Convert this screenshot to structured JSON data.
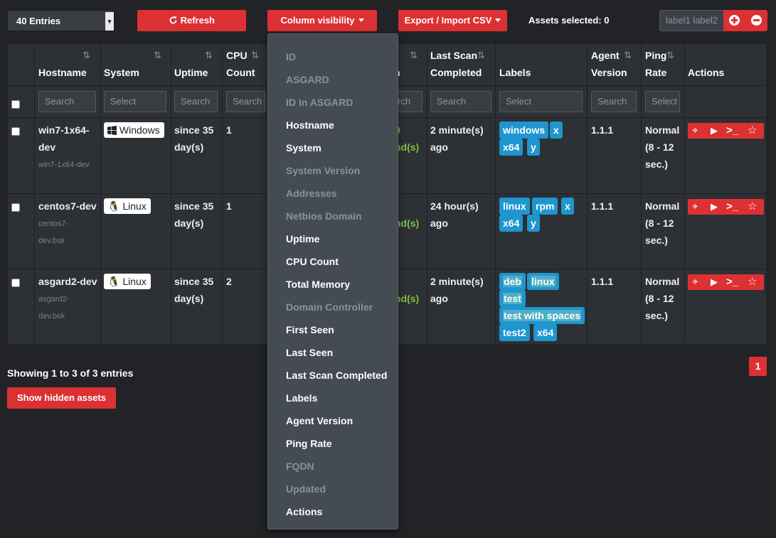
{
  "toolbar": {
    "entries": "40 Entries",
    "refresh": "Refresh",
    "column_visibility": "Column visibility",
    "export_import": "Export / Import CSV",
    "assets_selected": "Assets selected: 0",
    "label_input_placeholder": "label1 label2"
  },
  "columns": {
    "hostname": "Hostname",
    "system": "System",
    "uptime": "Uptime",
    "cpu_count_1": "CPU",
    "cpu_count_2": "Count",
    "partial_col": "n",
    "last_scan_1": "Last Scan",
    "last_scan_2": "Completed",
    "labels": "Labels",
    "agent_version_1": "Agent",
    "agent_version_2": "Version",
    "ping_rate_1": "Ping",
    "ping_rate_2": "Rate",
    "actions": "Actions"
  },
  "filters": {
    "hostname": "Search",
    "system": "Select",
    "uptime": "Search",
    "cpu": "Search",
    "partial": "rch",
    "last_scan": "Search",
    "labels": "Select",
    "agent": "Search",
    "ping": "Select"
  },
  "rows": [
    {
      "hostname_1": "win7-1x64-",
      "hostname_2": "dev",
      "fqdn_1": "win7-1x64-dev",
      "fqdn_2": "",
      "system": "Windows",
      "uptime_1": "since 35",
      "uptime_2": "day(s)",
      "cpu": "1",
      "partial_1": "0",
      "partial_2": "nd(s)",
      "last_scan_1": "2 minute(s)",
      "last_scan_2": "ago",
      "labels": [
        "windows",
        "x",
        "x64",
        "y"
      ],
      "agent": "1.1.1",
      "ping_1": "Normal",
      "ping_2": "(8 - 12",
      "ping_3": "sec.)"
    },
    {
      "hostname_1": "centos7-dev",
      "hostname_2": "",
      "fqdn_1": "centos7-",
      "fqdn_2": "dev.bsk",
      "system": "Linux",
      "uptime_1": "since 35",
      "uptime_2": "day(s)",
      "cpu": "1",
      "partial_1": "",
      "partial_2": "nd(s)",
      "last_scan_1": "24 hour(s)",
      "last_scan_2": "ago",
      "labels": [
        "linux",
        "rpm",
        "x",
        "x64",
        "y"
      ],
      "agent": "1.1.1",
      "ping_1": "Normal",
      "ping_2": "(8 - 12",
      "ping_3": "sec.)"
    },
    {
      "hostname_1": "asgard2-dev",
      "hostname_2": "",
      "fqdn_1": "asgard2-",
      "fqdn_2": "dev.bsk",
      "system": "Linux",
      "uptime_1": "since 35",
      "uptime_2": "day(s)",
      "cpu": "2",
      "partial_1": "",
      "partial_2": "nd(s)",
      "last_scan_1": "2 minute(s)",
      "last_scan_2": "ago",
      "labels": [
        "deb",
        "linux",
        "test",
        "test with spaces",
        "test2",
        "x64"
      ],
      "agent": "1.1.1",
      "ping_1": "Normal",
      "ping_2": "(8 - 12",
      "ping_3": "sec.)"
    }
  ],
  "footer": {
    "showing": "Showing 1 to 3 of 3 entries",
    "show_hidden": "Show hidden assets",
    "page": "1"
  },
  "column_menu": [
    {
      "label": "ID",
      "visible": false
    },
    {
      "label": "ASGARD",
      "visible": false
    },
    {
      "label": "ID in ASGARD",
      "visible": false
    },
    {
      "label": "Hostname",
      "visible": true
    },
    {
      "label": "System",
      "visible": true
    },
    {
      "label": "System Version",
      "visible": false
    },
    {
      "label": "Addresses",
      "visible": false
    },
    {
      "label": "Netbios Domain",
      "visible": false
    },
    {
      "label": "Uptime",
      "visible": true
    },
    {
      "label": "CPU Count",
      "visible": true
    },
    {
      "label": "Total Memory",
      "visible": true
    },
    {
      "label": "Domain Controller",
      "visible": false
    },
    {
      "label": "First Seen",
      "visible": true
    },
    {
      "label": "Last Seen",
      "visible": true
    },
    {
      "label": "Last Scan Completed",
      "visible": true
    },
    {
      "label": "Labels",
      "visible": true
    },
    {
      "label": "Agent Version",
      "visible": true
    },
    {
      "label": "Ping Rate",
      "visible": true
    },
    {
      "label": "FQDN",
      "visible": false
    },
    {
      "label": "Updated",
      "visible": false
    },
    {
      "label": "Actions",
      "visible": true
    }
  ],
  "colors": {
    "accent": "#dc3132",
    "label_tag": "#1e96cf",
    "success_text": "#7bc043"
  }
}
